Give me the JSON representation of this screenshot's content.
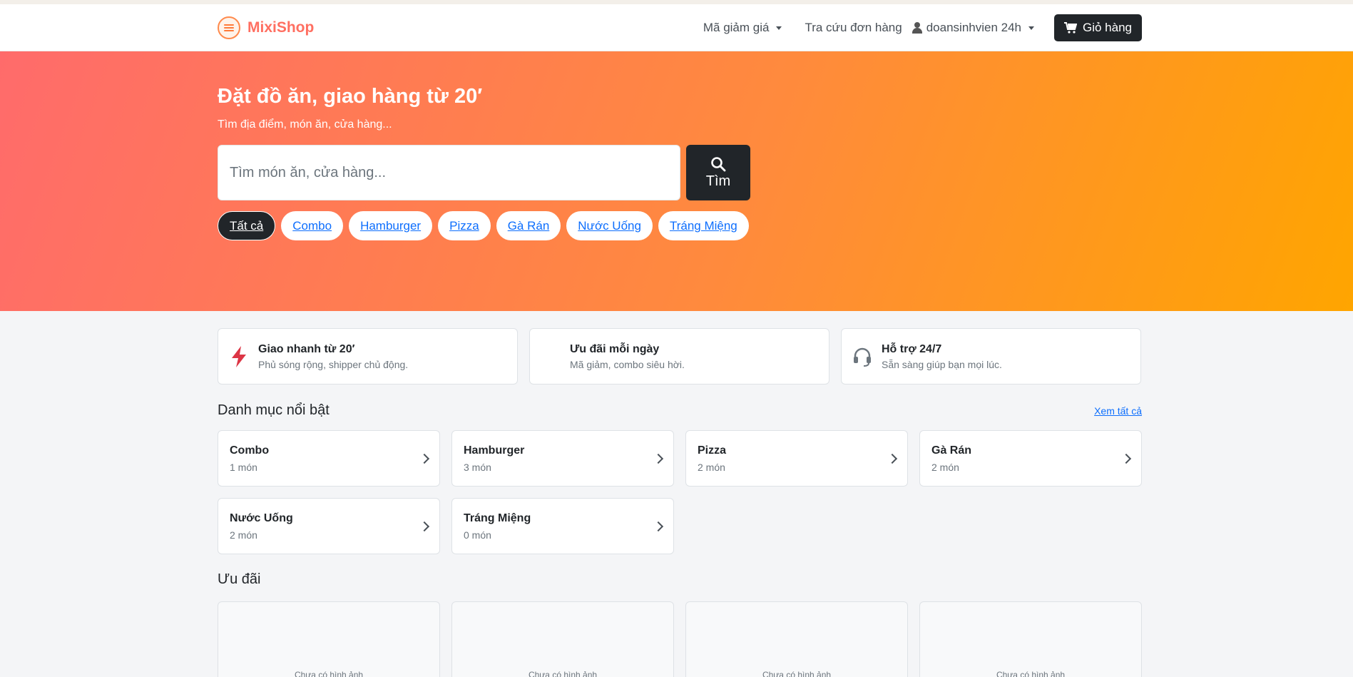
{
  "brand": {
    "name": "MixiShop"
  },
  "nav": {
    "discount": "Mã giảm giá",
    "order_lookup": "Tra cứu đơn hàng",
    "user": "doansinhvien 24h",
    "cart": "Giỏ hàng"
  },
  "hero": {
    "title": "Đặt đồ ăn, giao hàng từ 20′",
    "subtitle": "Tìm địa điểm, món ăn, cửa hàng...",
    "search_placeholder": "Tìm món ăn, cửa hàng...",
    "search_button": "Tìm",
    "chips": [
      "Tất cả",
      "Combo",
      "Hamburger",
      "Pizza",
      "Gà Rán",
      "Nước Uống",
      "Tráng Miệng"
    ]
  },
  "features": [
    {
      "title": "Giao nhanh từ 20′",
      "desc": "Phủ sóng rộng, shipper chủ động.",
      "icon": "lightning-icon"
    },
    {
      "title": "Ưu đãi mỗi ngày",
      "desc": "Mã giảm, combo siêu hời.",
      "icon": ""
    },
    {
      "title": "Hỗ trợ 24/7",
      "desc": "Sẵn sàng giúp bạn mọi lúc.",
      "icon": "headset-icon"
    }
  ],
  "categories_section": {
    "title": "Danh mục nổi bật",
    "see_all": "Xem tất cả"
  },
  "categories": [
    {
      "name": "Combo",
      "count": "1 món"
    },
    {
      "name": "Hamburger",
      "count": "3 món"
    },
    {
      "name": "Pizza",
      "count": "2 món"
    },
    {
      "name": "Gà Rán",
      "count": "2 món"
    },
    {
      "name": "Nước Uống",
      "count": "2 món"
    },
    {
      "name": "Tráng Miệng",
      "count": "0 món"
    }
  ],
  "promos_section": {
    "title": "Ưu đãi"
  },
  "promos": [
    {
      "placeholder": "Chưa có hình ảnh"
    },
    {
      "placeholder": "Chưa có hình ảnh"
    },
    {
      "placeholder": "Chưa có hình ảnh"
    },
    {
      "placeholder": "Chưa có hình ảnh"
    }
  ],
  "colors": {
    "brand": "#ff6f61",
    "dark": "#212529",
    "link": "#0d6efd",
    "accent_icon": "#dc3545"
  }
}
